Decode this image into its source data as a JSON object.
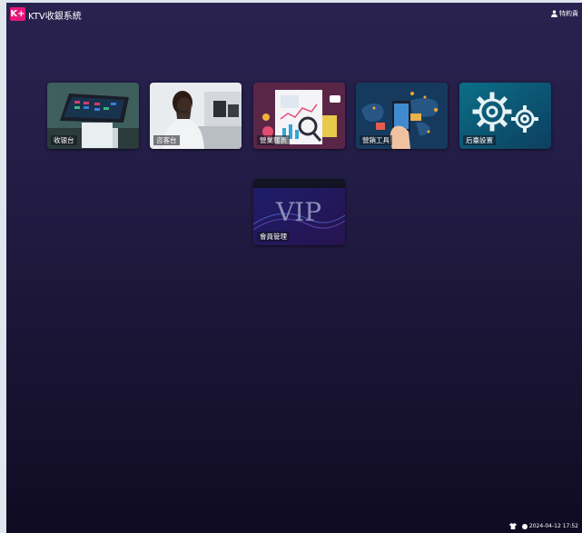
{
  "app": {
    "logo": "K+",
    "title": "KTV收銀系統"
  },
  "user": {
    "name": "特約貴"
  },
  "tiles": [
    {
      "label": "收银台"
    },
    {
      "label": "咨客台"
    },
    {
      "label": "營業報表"
    },
    {
      "label": "營銷工具"
    },
    {
      "label": "后臺設置"
    },
    {
      "label": "會員管理",
      "art_text": "VIP"
    }
  ],
  "footer": {
    "datetime": "2024-04-12 17:52"
  }
}
